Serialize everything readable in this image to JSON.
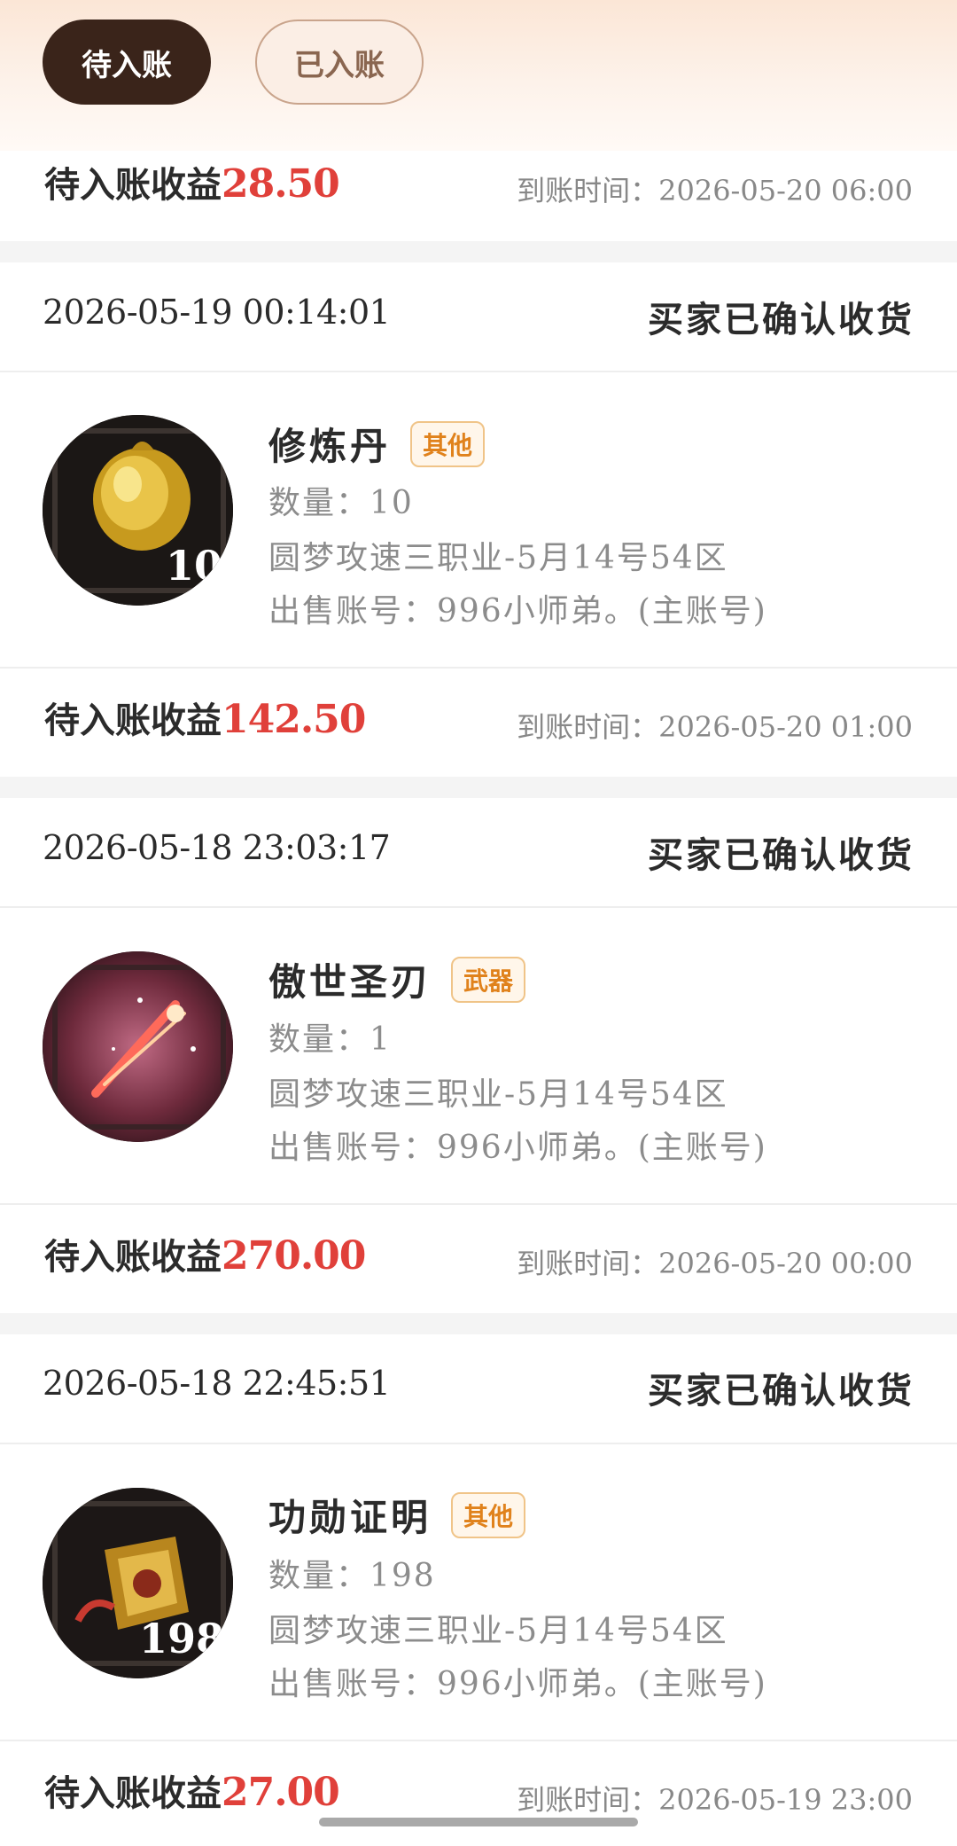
{
  "tabs": [
    {
      "label": "待入账",
      "active": true
    },
    {
      "label": "已入账",
      "active": false
    }
  ],
  "earnings_label": "待入账收益",
  "arrival_label": "到账时间：",
  "top_partial": {
    "earnings": "28.50",
    "arrival_time": "2026-05-20 06:00"
  },
  "orders": [
    {
      "time": "2026-05-19 00:14:01",
      "status": "买家已确认收货",
      "item_name": "修炼丹",
      "tag": "其他",
      "quantity_line": "数量：10",
      "server": "圆梦攻速三职业-5月14号54区",
      "account": "出售账号：996小师弟。(主账号)",
      "icon_count": "10",
      "icon": "golden-pill-icon",
      "earnings": "142.50",
      "arrival_time": "2026-05-20 01:00"
    },
    {
      "time": "2026-05-18 23:03:17",
      "status": "买家已确认收货",
      "item_name": "傲世圣刃",
      "tag": "武器",
      "quantity_line": "数量：1",
      "server": "圆梦攻速三职业-5月14号54区",
      "account": "出售账号：996小师弟。(主账号)",
      "icon_count": "",
      "icon": "sword-icon",
      "earnings": "270.00",
      "arrival_time": "2026-05-20 00:00"
    },
    {
      "time": "2026-05-18 22:45:51",
      "status": "买家已确认收货",
      "item_name": "功勋证明",
      "tag": "其他",
      "quantity_line": "数量：198",
      "server": "圆梦攻速三职业-5月14号54区",
      "account": "出售账号：996小师弟。(主账号)",
      "icon_count": "198",
      "icon": "medal-certificate-icon",
      "earnings": "27.00",
      "arrival_time": "2026-05-19 23:00"
    }
  ],
  "colors": {
    "accent_red": "#e0403a",
    "tag_orange": "#e0821c",
    "active_tab": "#3a241a"
  }
}
